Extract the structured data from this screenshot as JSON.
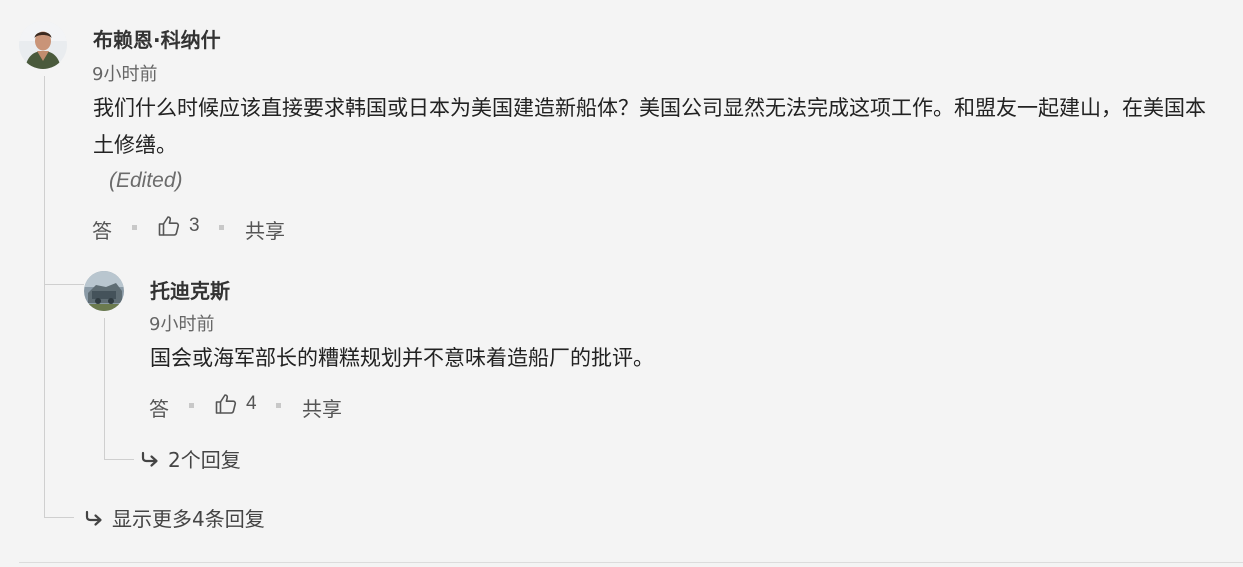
{
  "comment": {
    "author": "布赖恩·科纳什",
    "timestamp": "9小时前",
    "text": "我们什么时候应该直接要求韩国或日本为美国建造新船体？美国公司显然无法完成这项工作。和盟友一起建山，在美国本土修缮。",
    "edited": "(Edited)",
    "actions": {
      "reply": "答",
      "likes": "3",
      "share": "共享"
    }
  },
  "reply": {
    "author": "托迪克斯",
    "timestamp": "9小时前",
    "text": "国会或海军部长的糟糕规划并不意味着造船厂的批评。",
    "actions": {
      "reply": "答",
      "likes": "4",
      "share": "共享"
    },
    "replies_link": "2个回复"
  },
  "more_replies_link": "显示更多4条回复",
  "icons": {
    "like": "thumbs-up-icon",
    "reply_arrow": "reply-arrow-icon"
  },
  "colors": {
    "background": "#f4f4f4",
    "text": "#222222",
    "muted": "#666666",
    "thread_line": "#cfcfcf"
  }
}
